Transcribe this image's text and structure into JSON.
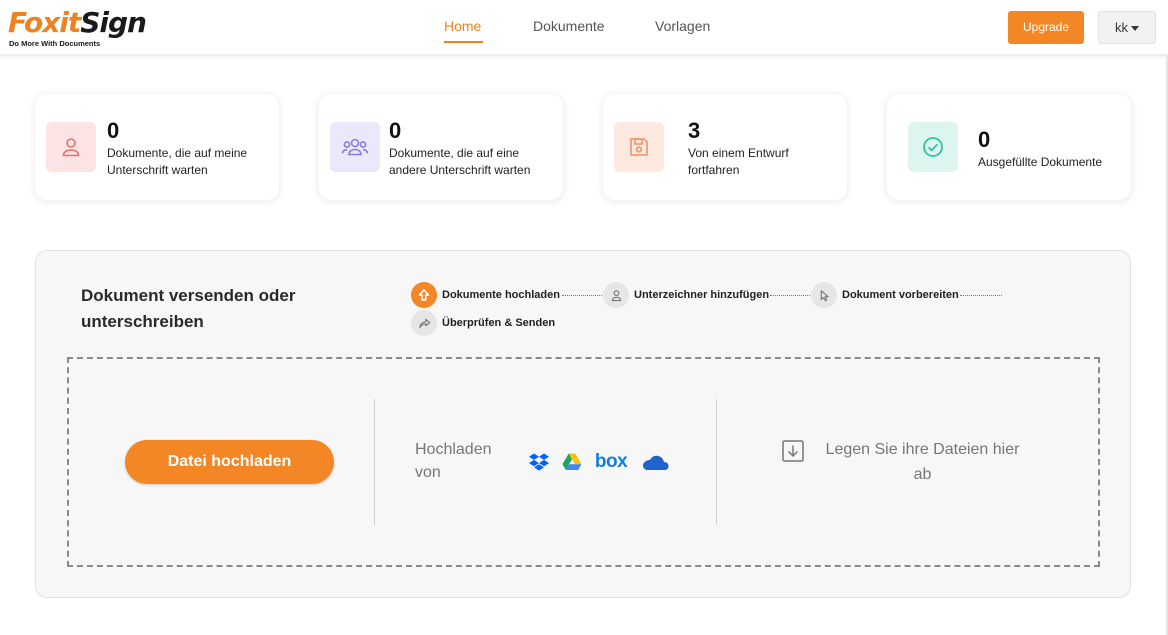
{
  "app": {
    "logo_name": "FoxitSign",
    "logo_word_1": "Foxit",
    "logo_word_2": "Sign",
    "logo_tagline": "Do More With Documents",
    "brand_color": "#f38625"
  },
  "nav": {
    "items": [
      {
        "label": "Home",
        "active": true
      },
      {
        "label": "Dokumente",
        "active": false
      },
      {
        "label": "Vorlagen",
        "active": false
      }
    ],
    "upgrade_label": "Upgrade",
    "user_label": "kk"
  },
  "stats": [
    {
      "count": "0",
      "label": "Dokumente, die auf meine Unterschrift warten",
      "icon": "user-icon",
      "color": "#f06b6b"
    },
    {
      "count": "0",
      "label": "Dokumente, die auf eine andere Unterschrift warten",
      "icon": "users-icon",
      "color": "#8b7be0"
    },
    {
      "count": "3",
      "label": "Von einem Entwurf fortfahren",
      "icon": "save-icon",
      "color": "#f2916a"
    },
    {
      "count": "0",
      "label": "Ausgefüllte Dokumente",
      "icon": "check-circle-icon",
      "color": "#2ec4a3"
    }
  ],
  "send": {
    "title": "Dokument versenden oder unterschreiben",
    "steps": [
      {
        "label": "Dokumente hochladen",
        "icon": "upload-arrow-icon",
        "active": true
      },
      {
        "label": "Unterzeichner hinzufügen",
        "icon": "user-icon",
        "active": false
      },
      {
        "label": "Dokument vorbereiten",
        "icon": "cursor-icon",
        "active": false
      },
      {
        "label": "Überprüfen & Senden",
        "icon": "share-arrow-icon",
        "active": false
      }
    ],
    "upload_button": "Datei hochladen",
    "upload_from_label": "Hochladen von",
    "cloud_sources": [
      "dropbox-icon",
      "google-drive-icon",
      "box-icon",
      "onedrive-icon"
    ],
    "box_text": "box",
    "drop_text": "Legen Sie ihre Dateien hier ab"
  }
}
